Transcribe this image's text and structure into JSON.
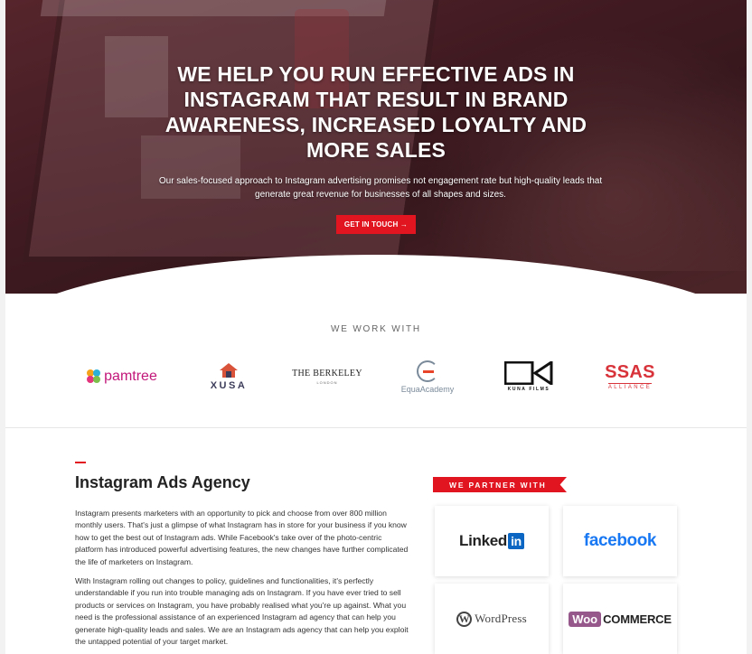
{
  "hero": {
    "title": "WE HELP YOU RUN EFFECTIVE ADS IN INSTAGRAM THAT RESULT IN BRAND AWARENESS, INCREASED LOYALTY AND MORE SALES",
    "subtitle": "Our sales-focused approach to Instagram advertising promises not engagement rate but high-quality leads that generate great revenue for businesses of all shapes and sizes.",
    "cta_label": "GET IN TOUCH →",
    "accent_color": "#e0151f"
  },
  "clients": {
    "title": "WE WORK WITH",
    "logos": [
      {
        "name": "pamtree",
        "text": "pamtree"
      },
      {
        "name": "xusa",
        "text": "XUSA"
      },
      {
        "name": "the-berkeley",
        "text": "THE BERKELEY",
        "sub": "LONDON"
      },
      {
        "name": "equa-academy",
        "text": "EquaAcademy"
      },
      {
        "name": "kuna-films",
        "text": "KUNA FILMS"
      },
      {
        "name": "ssas-alliance",
        "text": "SSAS",
        "sub": "ALLIANCE"
      }
    ]
  },
  "agency": {
    "title": "Instagram Ads Agency",
    "paragraph1": "Instagram presents marketers with an opportunity to pick and choose from over 800 million monthly users.  That's just a glimpse of what Instagram has in store for your business if you know how to get the best out of Instagram ads. While Facebook's take over of the photo-centric platform has introduced powerful advertising features, the new changes have further complicated the life of marketers on Instagram.",
    "paragraph2": "With Instagram rolling out changes to policy, guidelines and functionalities, it's perfectly understandable if you run into trouble managing ads on Instagram. If you have ever tried to sell products or services on Instagram, you have probably realised what you're up against. What you need is the professional assistance of an experienced Instagram ad agency that can help you generate high-quality leads and sales. We are an Instagram ads agency that can help you exploit the untapped potential of your target market."
  },
  "partners": {
    "title": "WE PARTNER WITH",
    "linkedin": {
      "text": "Linked",
      "box": "in"
    },
    "facebook": "facebook",
    "wordpress": {
      "mark": "W",
      "text": "WordPress"
    },
    "woocommerce": {
      "badge": "Woo",
      "text": "COMMERCE"
    }
  }
}
